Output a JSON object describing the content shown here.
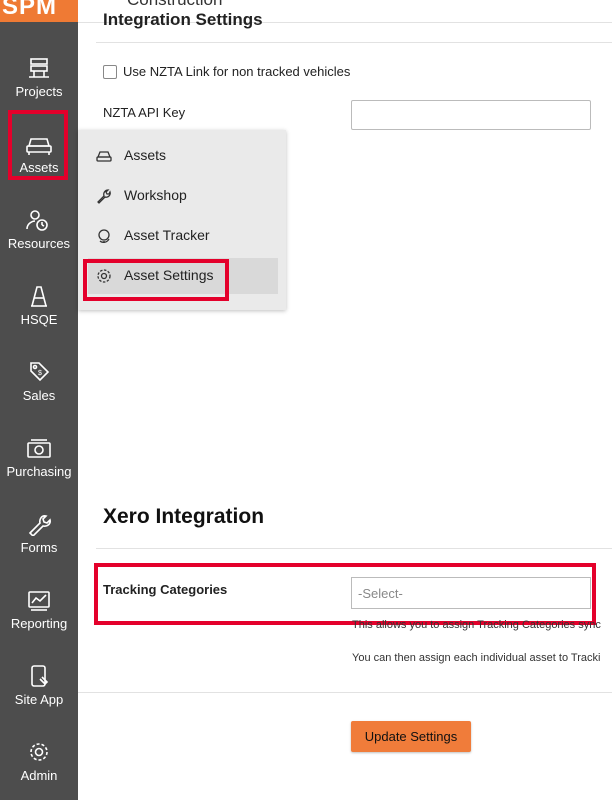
{
  "app": {
    "logo_text": "SPM",
    "brand_color": "#ef7a34",
    "highlight_color": "#e4002b",
    "page_title_partial": "Construction"
  },
  "sidebar": {
    "items": [
      {
        "label": "Projects",
        "icon": "projects-icon"
      },
      {
        "label": "Assets",
        "icon": "car-icon",
        "active": true
      },
      {
        "label": "Resources",
        "icon": "resources-icon"
      },
      {
        "label": "HSQE",
        "icon": "hsqe-icon"
      },
      {
        "label": "Sales",
        "icon": "tag-icon"
      },
      {
        "label": "Purchasing",
        "icon": "purchasing-icon"
      },
      {
        "label": "Forms",
        "icon": "wrench-icon"
      },
      {
        "label": "Reporting",
        "icon": "chart-icon"
      },
      {
        "label": "Site App",
        "icon": "mobile-icon"
      },
      {
        "label": "Admin",
        "icon": "gear-icon"
      }
    ]
  },
  "assets_menu": {
    "items": [
      {
        "label": "Assets",
        "icon": "car-icon"
      },
      {
        "label": "Workshop",
        "icon": "wrench-icon"
      },
      {
        "label": "Asset Tracker",
        "icon": "globe-icon"
      },
      {
        "label": "Asset Settings",
        "icon": "gear-icon",
        "hovered": true
      }
    ]
  },
  "integration": {
    "heading_partial": "Integration Settings",
    "checkbox_label": "Use NZTA Link for non tracked vehicles",
    "checkbox_checked": false,
    "api_key_label": "NZTA API Key",
    "api_key_value": ""
  },
  "xero": {
    "heading": "Xero Integration",
    "tracking_label": "Tracking Categories",
    "select_placeholder": "-Select-",
    "help_line_1": "This allows you to assign Tracking Categories sync",
    "help_line_2": "You can then assign each individual asset to Tracki"
  },
  "actions": {
    "update_label": "Update Settings"
  }
}
